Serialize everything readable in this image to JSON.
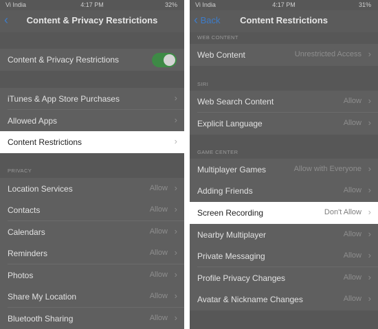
{
  "left": {
    "status": {
      "carrier": "Vi India",
      "time": "4:17 PM",
      "battery": "32%"
    },
    "nav_title": "Content & Privacy Restrictions",
    "toggle_label": "Content & Privacy Restrictions",
    "toggle_on": true,
    "rows": [
      {
        "label": "iTunes & App Store Purchases"
      },
      {
        "label": "Allowed Apps"
      },
      {
        "label": "Content Restrictions",
        "highlighted": true
      }
    ],
    "privacy_header": "PRIVACY",
    "privacy_rows": [
      {
        "label": "Location Services",
        "value": "Allow"
      },
      {
        "label": "Contacts",
        "value": "Allow"
      },
      {
        "label": "Calendars",
        "value": "Allow"
      },
      {
        "label": "Reminders",
        "value": "Allow"
      },
      {
        "label": "Photos",
        "value": "Allow"
      },
      {
        "label": "Share My Location",
        "value": "Allow"
      },
      {
        "label": "Bluetooth Sharing",
        "value": "Allow"
      }
    ]
  },
  "right": {
    "status": {
      "carrier": "Vi India",
      "time": "4:17 PM",
      "battery": "31%"
    },
    "back_label": "Back",
    "nav_title": "Content Restrictions",
    "web_header": "WEB CONTENT",
    "web_row": {
      "label": "Web Content",
      "value": "Unrestricted Access"
    },
    "siri_header": "SIRI",
    "siri_rows": [
      {
        "label": "Web Search Content",
        "value": "Allow"
      },
      {
        "label": "Explicit Language",
        "value": "Allow"
      }
    ],
    "gc_header": "GAME CENTER",
    "gc_rows": [
      {
        "label": "Multiplayer Games",
        "value": "Allow with Everyone"
      },
      {
        "label": "Adding Friends",
        "value": "Allow"
      },
      {
        "label": "Screen Recording",
        "value": "Don't Allow",
        "highlighted": true
      },
      {
        "label": "Nearby Multiplayer",
        "value": "Allow"
      },
      {
        "label": "Private Messaging",
        "value": "Allow"
      },
      {
        "label": "Profile Privacy Changes",
        "value": "Allow"
      },
      {
        "label": "Avatar & Nickname Changes",
        "value": "Allow"
      }
    ]
  },
  "icons": [
    "back-chevron-icon",
    "chevron-right-icon",
    "wifi-icon",
    "battery-icon"
  ],
  "colors": {
    "toggle_on": "#3e8a46",
    "link": "#3d7cc9",
    "dim_bg": "#575757",
    "highlight_bg": "#ffffff"
  }
}
